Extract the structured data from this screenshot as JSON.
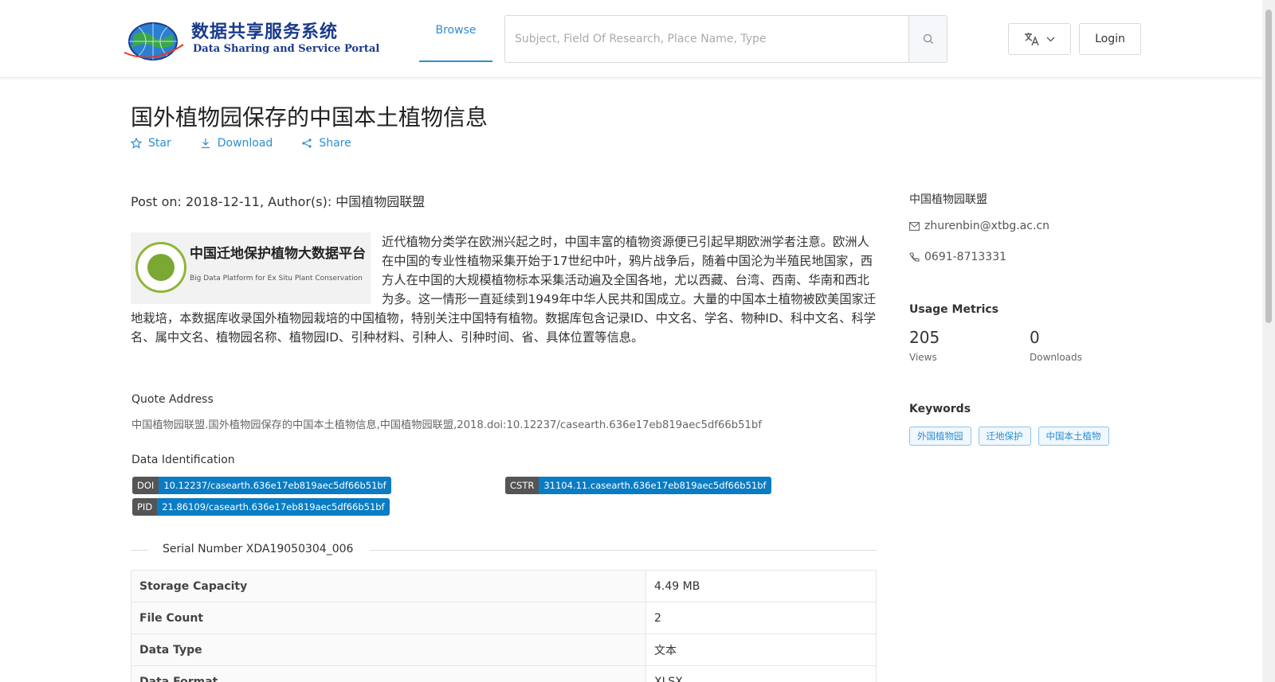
{
  "header": {
    "logo_cn": "数据共享服务系统",
    "logo_en": "Data Sharing and Service Portal",
    "nav_browse": "Browse",
    "search_placeholder": "Subject, Field Of Research, Place Name, Type",
    "login_label": "Login",
    "accent_color": "#2a8fd6"
  },
  "dataset": {
    "title": "国外植物园保存的中国本土植物信息",
    "actions": {
      "star": "Star",
      "download": "Download",
      "share": "Share"
    },
    "post_on": "Post on: 2018-12-11, Author(s): 中国植物园联盟",
    "thumbnail": {
      "title_cn": "中国迁地保护植物大数据平台",
      "title_en": "Big Data Platform for Ex Situ Plant Conservation"
    },
    "description": "近代植物分类学在欧洲兴起之时，中国丰富的植物资源便已引起早期欧洲学者注意。欧洲人在中国的专业性植物采集开始于17世纪中叶，鸦片战争后，随着中国沦为半殖民地国家，西方人在中国的大规模植物标本采集活动遍及全国各地，尤以西藏、台湾、西南、华南和西北为多。这一情形一直延续到1949年中华人民共和国成立。大量的中国本土植物被欧美国家迁地栽培，本数据库收录国外植物园栽培的中国植物，特别关注中国特有植物。数据库包含记录ID、中文名、学名、物种ID、科中文名、科学名、属中文名、植物园名称、植物园ID、引种材料、引种人、引种时间、省、具体位置等信息。",
    "quote_label": "Quote Address",
    "quote_text": "中国植物园联盟.国外植物园保存的中国本土植物信息,中国植物园联盟,2018.doi:10.12237/casearth.636e17eb819aec5df66b51bf",
    "identification_label": "Data Identification",
    "identifiers": {
      "doi": {
        "key": "DOI",
        "value": "10.12237/casearth.636e17eb819aec5df66b51bf"
      },
      "cstr": {
        "key": "CSTR",
        "value": "31104.11.casearth.636e17eb819aec5df66b51bf"
      },
      "pid": {
        "key": "PID",
        "value": "21.86109/casearth.636e17eb819aec5df66b51bf"
      }
    },
    "serial_number": "Serial Number XDA19050304_006",
    "info_rows": [
      {
        "key": "Storage Capacity",
        "value": "4.49 MB"
      },
      {
        "key": "File Count",
        "value": "2"
      },
      {
        "key": "Data Type",
        "value": "文本"
      },
      {
        "key": "Data Format",
        "value": "XLSX"
      }
    ]
  },
  "sidebar": {
    "org": "中国植物园联盟",
    "email": "zhurenbin@xtbg.ac.cn",
    "phone": "0691-8713331",
    "usage_title": "Usage Metrics",
    "views_count": "205",
    "views_label": "Views",
    "downloads_count": "0",
    "downloads_label": "Downloads",
    "keywords_title": "Keywords",
    "keywords": [
      "外国植物园",
      "迁地保护",
      "中国本土植物"
    ]
  }
}
